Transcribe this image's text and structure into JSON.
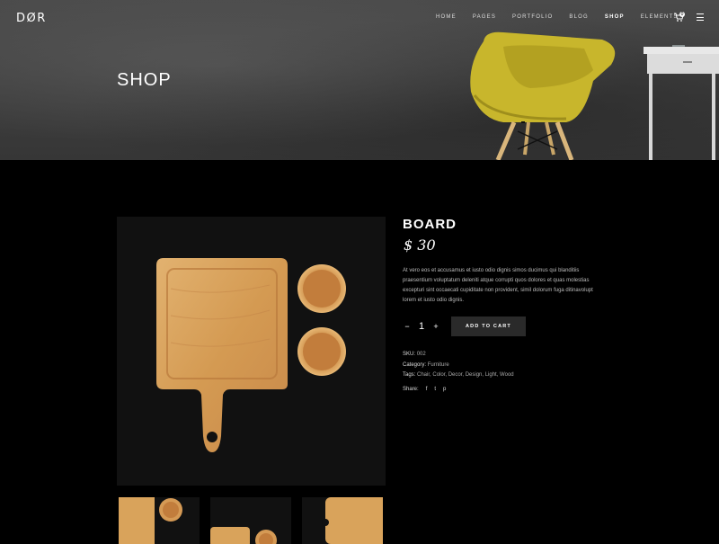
{
  "header": {
    "logo": "DØR",
    "nav": [
      {
        "label": "HOME"
      },
      {
        "label": "PAGES"
      },
      {
        "label": "PORTFOLIO"
      },
      {
        "label": "BLOG"
      },
      {
        "label": "SHOP"
      },
      {
        "label": "ELEMENTS"
      }
    ],
    "active_nav": "SHOP",
    "cart_count": "0",
    "icons": [
      "cart-icon",
      "menu-icon"
    ]
  },
  "hero": {
    "title": "SHOP"
  },
  "product": {
    "title": "BOARD",
    "price": "$ 30",
    "description": "At vero eos et accusamus et iusto odio dignis simos ducimus qui blanditiis praesentium voluptatum deleniti atque corrupti quos dolores et quas molestias excepturi sint occaecati cupiditate non provident, simil dolorum fuga ditinavolupt lorem et iusto odio dignis.",
    "quantity": "1",
    "qty_minus": "−",
    "qty_plus": "+",
    "add_to_cart": "ADD TO CART",
    "sku_label": "SKU:",
    "sku": "002",
    "category_label": "Category:",
    "category": "Furniture",
    "tags_label": "Tags:",
    "tags": "Chair, Color, Decor, Design, Light, Wood",
    "share_label": "Share:",
    "share_icons": [
      "facebook-icon",
      "twitter-icon",
      "pinterest-icon"
    ],
    "share_glyphs": {
      "facebook": "f",
      "twitter": "t",
      "pinterest": "p"
    }
  },
  "colors": {
    "background": "#000000",
    "wood": "#d9a35b",
    "chair": "#c9b52a",
    "button": "#2a2a2a"
  }
}
